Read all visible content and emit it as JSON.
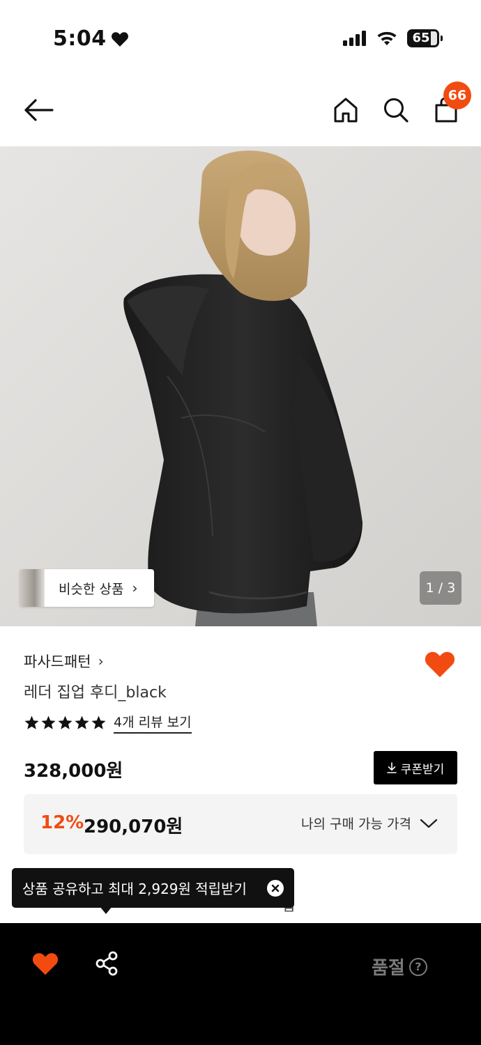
{
  "status_bar": {
    "time": "5:04",
    "battery": "65"
  },
  "header": {
    "cart_count": "66"
  },
  "gallery": {
    "similar_label": "비슷한 상품",
    "counter": "1 / 3"
  },
  "product": {
    "brand": "파사드패턴",
    "name": "레더 집업 후디_black",
    "rating_stars": 5,
    "review_link": "4개 리뷰 보기",
    "price": "328,000원",
    "coupon_label": "쿠폰받기",
    "discount_percent": "12%",
    "discount_price": "290,070원",
    "my_price_label": "나의 구매 가능 가격",
    "obscured_row_tail": "업"
  },
  "tooltip": {
    "text": "상품 공유하고 최대 2,929원 적립받기"
  },
  "bottom_bar": {
    "status_label": "품절",
    "help_symbol": "?"
  },
  "colors": {
    "accent": "#f24b12",
    "bottom_bar": "#000000",
    "soldout_text": "#7a7a7a"
  }
}
